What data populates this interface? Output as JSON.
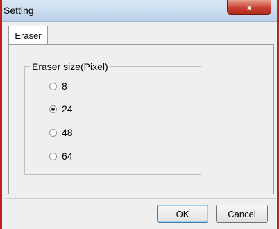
{
  "window": {
    "title": "Setting",
    "close_label": "x"
  },
  "tabs": [
    {
      "label": "Eraser"
    }
  ],
  "group": {
    "label": "Eraser size(Pixel)",
    "options": [
      {
        "label": "8",
        "selected": false
      },
      {
        "label": "24",
        "selected": true
      },
      {
        "label": "48",
        "selected": false
      },
      {
        "label": "64",
        "selected": false
      }
    ]
  },
  "buttons": {
    "ok": "OK",
    "cancel": "Cancel"
  },
  "colors": {
    "frame": "#c21f1f",
    "title_bg": "#cfe0f2",
    "close_bg": "#c74232"
  }
}
